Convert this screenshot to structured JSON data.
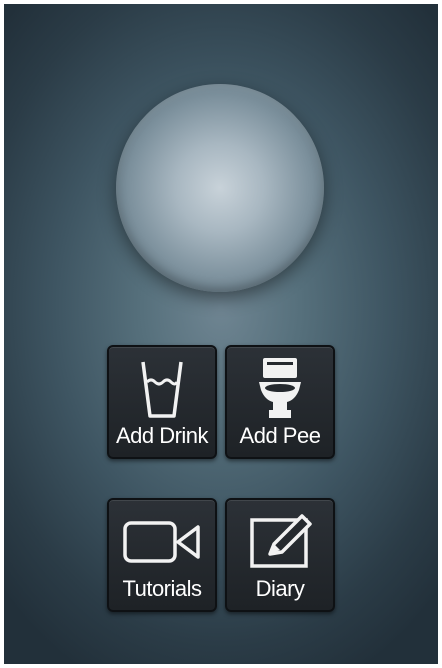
{
  "buttons": {
    "add_drink": {
      "label": "Add Drink",
      "icon": "glass-icon"
    },
    "add_pee": {
      "label": "Add Pee",
      "icon": "toilet-icon"
    },
    "tutorials": {
      "label": "Tutorials",
      "icon": "video-camera-icon"
    },
    "diary": {
      "label": "Diary",
      "icon": "pencil-edit-icon"
    }
  },
  "colors": {
    "background": "#3e5562",
    "tile": "#25292e",
    "label": "#ffffff",
    "icon": "#f2f2f2"
  }
}
